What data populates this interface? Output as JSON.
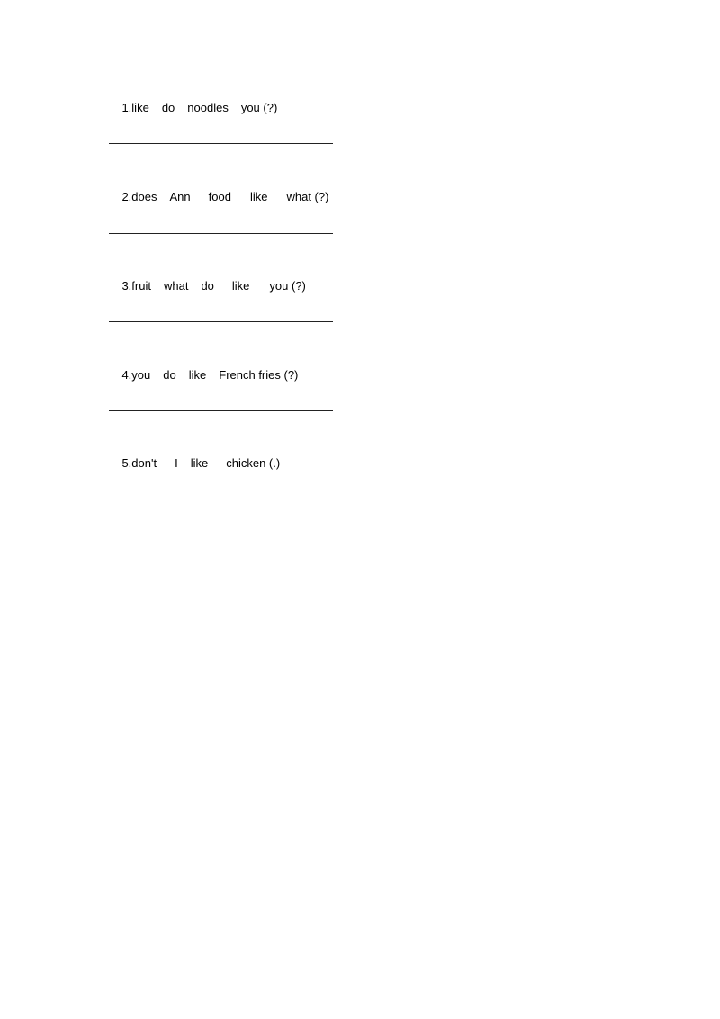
{
  "questions": [
    {
      "number": "1.",
      "words": [
        "like",
        "do",
        "noodles",
        "you (?)"
      ]
    },
    {
      "number": "2.",
      "words": [
        "does",
        "Ann",
        "food",
        "like",
        "what (?)"
      ]
    },
    {
      "number": "3.",
      "words": [
        "fruit",
        "what",
        "do",
        "like",
        "you (?)"
      ]
    },
    {
      "number": "4.",
      "words": [
        "you",
        "do",
        "like",
        "French fries (?)"
      ]
    },
    {
      "number": "5.",
      "words": [
        "don't",
        "I",
        "like",
        "chicken (.)"
      ]
    }
  ]
}
